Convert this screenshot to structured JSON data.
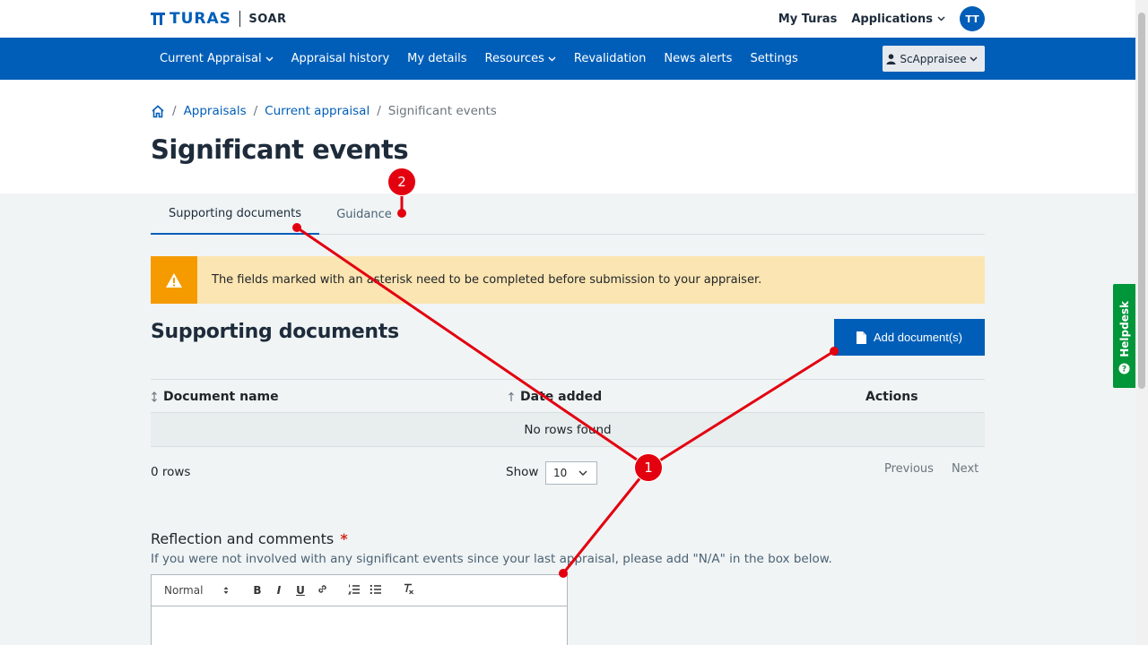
{
  "header": {
    "brand": "TURAS",
    "app_name": "SOAR",
    "links": [
      "My Turas",
      "Applications"
    ],
    "avatar_initials": "TT"
  },
  "nav": {
    "items": [
      {
        "label": "Current Appraisal",
        "dropdown": true
      },
      {
        "label": "Appraisal history",
        "dropdown": false
      },
      {
        "label": "My details",
        "dropdown": false
      },
      {
        "label": "Resources",
        "dropdown": true
      },
      {
        "label": "Revalidation",
        "dropdown": false
      },
      {
        "label": "News alerts",
        "dropdown": false
      },
      {
        "label": "Settings",
        "dropdown": false
      }
    ],
    "user": "ScAppraisee"
  },
  "breadcrumb": {
    "items": [
      "Appraisals",
      "Current appraisal"
    ],
    "current": "Significant events"
  },
  "page_title": "Significant events",
  "tabs": [
    "Supporting documents",
    "Guidance"
  ],
  "alert": {
    "text": "The fields marked with an asterisk need to be completed before submission to your appraiser."
  },
  "documents": {
    "title": "Supporting documents",
    "add_button": "Add document(s)",
    "columns": [
      "Document name",
      "Date added",
      "Actions"
    ],
    "empty": "No rows found",
    "row_count": "0 rows",
    "show_label": "Show",
    "page_size": "10",
    "prev": "Previous",
    "next": "Next"
  },
  "reflection": {
    "label": "Reflection and comments",
    "asterisk": "*",
    "hint": "If you were not involved with any significant events since your last appraisal, please add \"N/A\" in the box below.",
    "format": "Normal",
    "toolbar": [
      "B",
      "I",
      "U"
    ]
  },
  "helpdesk": "Helpdesk",
  "annotations": [
    "1",
    "2"
  ],
  "colors": {
    "primary": "#005eb8",
    "warning": "#f59b00",
    "warning_bg": "#fbe5b2",
    "helpdesk": "#009639",
    "annotation": "#e3000f"
  }
}
